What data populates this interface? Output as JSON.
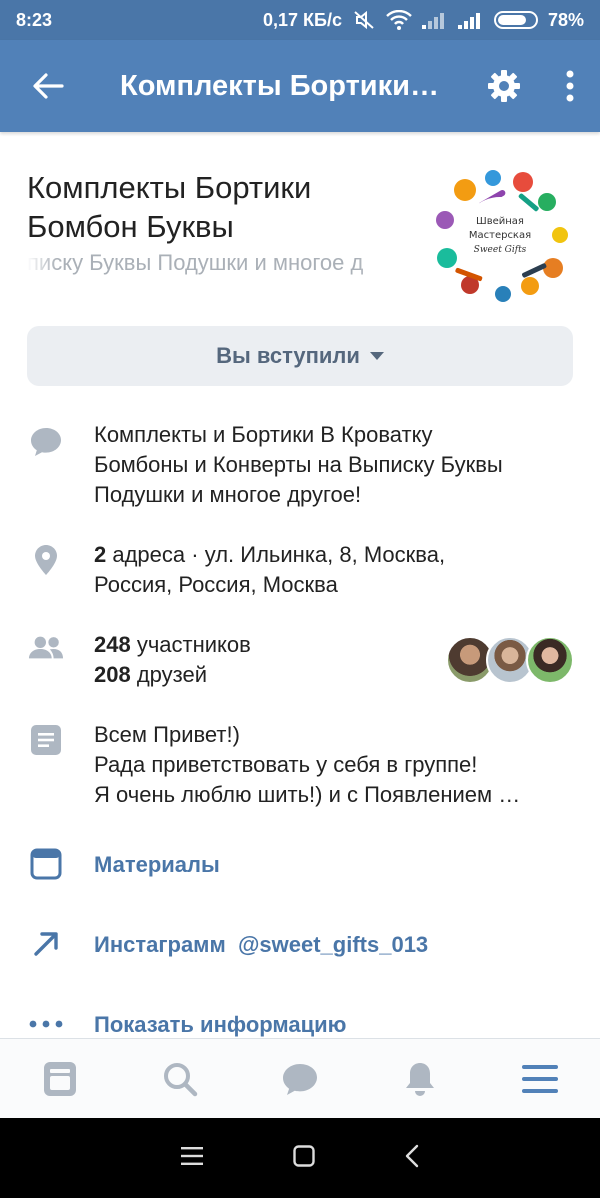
{
  "status_bar": {
    "time": "8:23",
    "network_speed": "0,17 КБ/с",
    "battery": "78%",
    "battery_level": 0.78
  },
  "header": {
    "title": "Комплекты Бортики…"
  },
  "group": {
    "name": "Комплекты Бортики Бомбон Буквы",
    "status": "писку Буквы Подушки и многое д",
    "avatar_text_1": "Швейная",
    "avatar_text_2": "Мастерская",
    "avatar_text_3": "Sweet Gifts"
  },
  "join_button": {
    "label": "Вы вступили"
  },
  "description": {
    "text_line1": "Комплекты и Бортики В Кроватку",
    "text_line2": "Бомбоны и Конверты на Выписку Буквы",
    "text_line3": "Подушки и многое другое!"
  },
  "address": {
    "count": "2",
    "count_label": " адреса · ул. Ильинка, 8, Москва,",
    "line2": "Россия, Россия, Москва"
  },
  "members": {
    "members_count": "248",
    "members_label": " участников",
    "friends_count": "208",
    "friends_label": " друзей"
  },
  "about": {
    "line1": "Всем Привет!)",
    "line2": "Рада приветствовать у себя в группе!",
    "line3": "Я очень люблю шить!) и с Появлением …"
  },
  "links": {
    "materials": "Материалы",
    "instagram": "Инстаграмм  @sweet_gifts_013",
    "show_info": "Показать информацию"
  },
  "colors": {
    "header": "#5181b8",
    "status_bar": "#4a76a8",
    "link": "#4a76a8",
    "icon_gray": "#aeb7c2"
  },
  "icons": {
    "back": "arrow-left-icon",
    "settings": "gear-icon",
    "more": "more-vertical-icon",
    "description": "speech-bubble-icon",
    "address": "location-pin-icon",
    "members": "people-icon",
    "about": "document-icon",
    "materials": "browser-window-icon",
    "link": "arrow-up-right-icon",
    "info": "more-horizontal-icon",
    "nav": [
      "news-icon",
      "search-icon",
      "messages-icon",
      "bell-icon",
      "menu-icon"
    ]
  }
}
